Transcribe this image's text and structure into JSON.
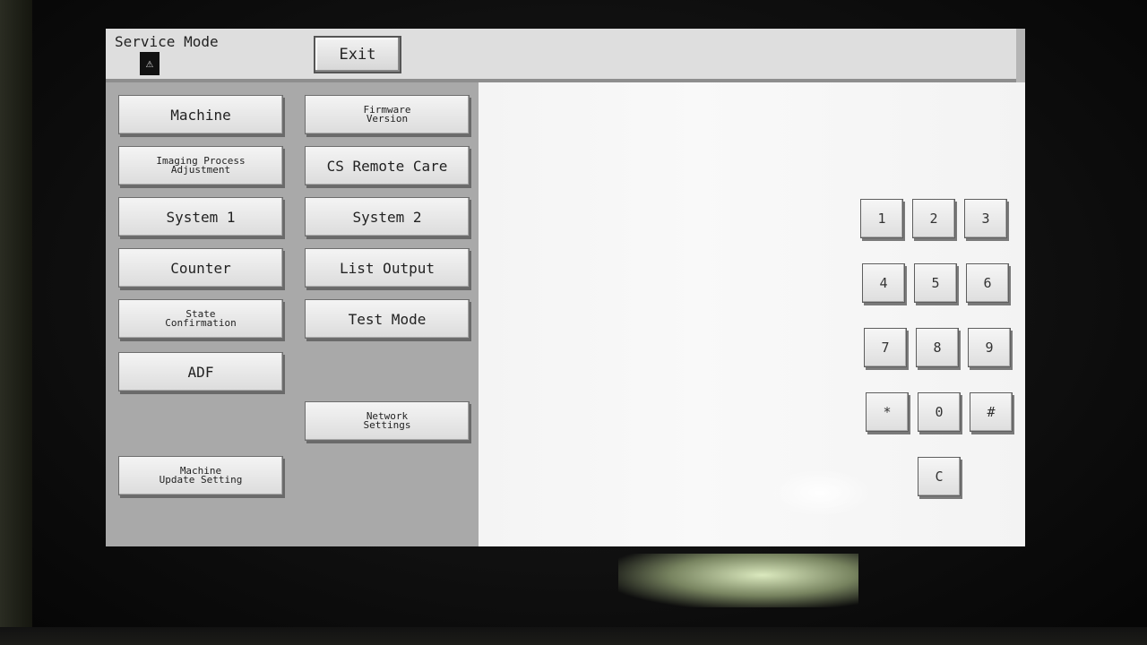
{
  "header": {
    "title": "Service Mode",
    "warning_icon_glyph": "⚠",
    "exit_label": "Exit"
  },
  "menu": {
    "machine": "Machine",
    "firmware_version": "Firmware\nVersion",
    "imaging_process_adjustment": "Imaging Process\nAdjustment",
    "cs_remote_care": "CS Remote Care",
    "system_1": "System 1",
    "system_2": "System 2",
    "counter": "Counter",
    "list_output": "List Output",
    "state_confirmation": "State\nConfirmation",
    "test_mode": "Test Mode",
    "adf": "ADF",
    "network_settings": "Network\nSettings",
    "machine_update_setting": "Machine\nUpdate Setting"
  },
  "keypad": {
    "k1": "1",
    "k2": "2",
    "k3": "3",
    "k4": "4",
    "k5": "5",
    "k6": "6",
    "k7": "7",
    "k8": "8",
    "k9": "9",
    "kstar": "*",
    "k0": "0",
    "khash": "#",
    "kclear": "C"
  },
  "colors": {
    "menu_panel": "#a9a9a9",
    "content_panel": "#f4f4f4",
    "title_bar": "#dedede"
  }
}
